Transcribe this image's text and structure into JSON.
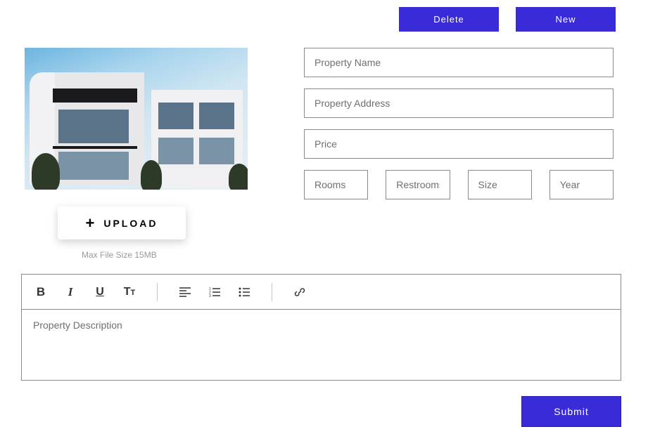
{
  "topButtons": {
    "delete": "Delete",
    "new": "New"
  },
  "upload": {
    "label": "UPLOAD",
    "hint": "Max File Size 15MB"
  },
  "fields": {
    "name": {
      "placeholder": "Property Name",
      "value": ""
    },
    "address": {
      "placeholder": "Property Address",
      "value": ""
    },
    "price": {
      "placeholder": "Price",
      "value": ""
    },
    "rooms": {
      "placeholder": "Rooms",
      "value": ""
    },
    "restrooms": {
      "placeholder": "Restrooms",
      "value": ""
    },
    "size": {
      "placeholder": "Size",
      "value": ""
    },
    "year": {
      "placeholder": "Year",
      "value": ""
    }
  },
  "editor": {
    "placeholder": "Property Description",
    "value": ""
  },
  "submit": "Submit",
  "icons": {
    "plus": "plus-icon",
    "bold": "bold-icon",
    "italic": "italic-icon",
    "underline": "underline-icon",
    "textsize": "text-size-icon",
    "alignleft": "align-left-icon",
    "numberlist": "numbered-list-icon",
    "bulletlist": "bullet-list-icon",
    "link": "link-icon"
  }
}
